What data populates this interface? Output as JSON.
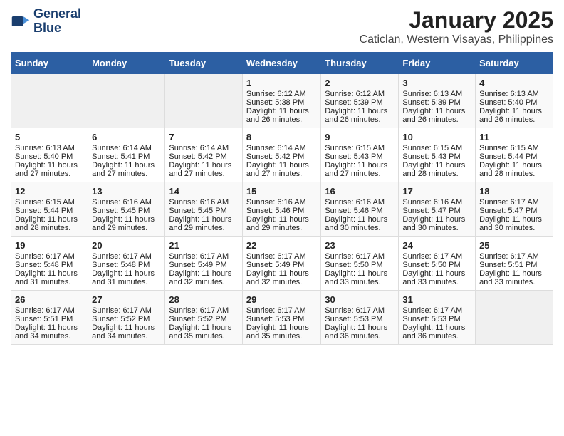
{
  "header": {
    "logo_line1": "General",
    "logo_line2": "Blue",
    "title": "January 2025",
    "subtitle": "Caticlan, Western Visayas, Philippines"
  },
  "weekdays": [
    "Sunday",
    "Monday",
    "Tuesday",
    "Wednesday",
    "Thursday",
    "Friday",
    "Saturday"
  ],
  "weeks": [
    [
      {
        "day": "",
        "sunrise": "",
        "sunset": "",
        "daylight": ""
      },
      {
        "day": "",
        "sunrise": "",
        "sunset": "",
        "daylight": ""
      },
      {
        "day": "",
        "sunrise": "",
        "sunset": "",
        "daylight": ""
      },
      {
        "day": "1",
        "sunrise": "Sunrise: 6:12 AM",
        "sunset": "Sunset: 5:38 PM",
        "daylight": "Daylight: 11 hours and 26 minutes."
      },
      {
        "day": "2",
        "sunrise": "Sunrise: 6:12 AM",
        "sunset": "Sunset: 5:39 PM",
        "daylight": "Daylight: 11 hours and 26 minutes."
      },
      {
        "day": "3",
        "sunrise": "Sunrise: 6:13 AM",
        "sunset": "Sunset: 5:39 PM",
        "daylight": "Daylight: 11 hours and 26 minutes."
      },
      {
        "day": "4",
        "sunrise": "Sunrise: 6:13 AM",
        "sunset": "Sunset: 5:40 PM",
        "daylight": "Daylight: 11 hours and 26 minutes."
      }
    ],
    [
      {
        "day": "5",
        "sunrise": "Sunrise: 6:13 AM",
        "sunset": "Sunset: 5:40 PM",
        "daylight": "Daylight: 11 hours and 27 minutes."
      },
      {
        "day": "6",
        "sunrise": "Sunrise: 6:14 AM",
        "sunset": "Sunset: 5:41 PM",
        "daylight": "Daylight: 11 hours and 27 minutes."
      },
      {
        "day": "7",
        "sunrise": "Sunrise: 6:14 AM",
        "sunset": "Sunset: 5:42 PM",
        "daylight": "Daylight: 11 hours and 27 minutes."
      },
      {
        "day": "8",
        "sunrise": "Sunrise: 6:14 AM",
        "sunset": "Sunset: 5:42 PM",
        "daylight": "Daylight: 11 hours and 27 minutes."
      },
      {
        "day": "9",
        "sunrise": "Sunrise: 6:15 AM",
        "sunset": "Sunset: 5:43 PM",
        "daylight": "Daylight: 11 hours and 27 minutes."
      },
      {
        "day": "10",
        "sunrise": "Sunrise: 6:15 AM",
        "sunset": "Sunset: 5:43 PM",
        "daylight": "Daylight: 11 hours and 28 minutes."
      },
      {
        "day": "11",
        "sunrise": "Sunrise: 6:15 AM",
        "sunset": "Sunset: 5:44 PM",
        "daylight": "Daylight: 11 hours and 28 minutes."
      }
    ],
    [
      {
        "day": "12",
        "sunrise": "Sunrise: 6:15 AM",
        "sunset": "Sunset: 5:44 PM",
        "daylight": "Daylight: 11 hours and 28 minutes."
      },
      {
        "day": "13",
        "sunrise": "Sunrise: 6:16 AM",
        "sunset": "Sunset: 5:45 PM",
        "daylight": "Daylight: 11 hours and 29 minutes."
      },
      {
        "day": "14",
        "sunrise": "Sunrise: 6:16 AM",
        "sunset": "Sunset: 5:45 PM",
        "daylight": "Daylight: 11 hours and 29 minutes."
      },
      {
        "day": "15",
        "sunrise": "Sunrise: 6:16 AM",
        "sunset": "Sunset: 5:46 PM",
        "daylight": "Daylight: 11 hours and 29 minutes."
      },
      {
        "day": "16",
        "sunrise": "Sunrise: 6:16 AM",
        "sunset": "Sunset: 5:46 PM",
        "daylight": "Daylight: 11 hours and 30 minutes."
      },
      {
        "day": "17",
        "sunrise": "Sunrise: 6:16 AM",
        "sunset": "Sunset: 5:47 PM",
        "daylight": "Daylight: 11 hours and 30 minutes."
      },
      {
        "day": "18",
        "sunrise": "Sunrise: 6:17 AM",
        "sunset": "Sunset: 5:47 PM",
        "daylight": "Daylight: 11 hours and 30 minutes."
      }
    ],
    [
      {
        "day": "19",
        "sunrise": "Sunrise: 6:17 AM",
        "sunset": "Sunset: 5:48 PM",
        "daylight": "Daylight: 11 hours and 31 minutes."
      },
      {
        "day": "20",
        "sunrise": "Sunrise: 6:17 AM",
        "sunset": "Sunset: 5:48 PM",
        "daylight": "Daylight: 11 hours and 31 minutes."
      },
      {
        "day": "21",
        "sunrise": "Sunrise: 6:17 AM",
        "sunset": "Sunset: 5:49 PM",
        "daylight": "Daylight: 11 hours and 32 minutes."
      },
      {
        "day": "22",
        "sunrise": "Sunrise: 6:17 AM",
        "sunset": "Sunset: 5:49 PM",
        "daylight": "Daylight: 11 hours and 32 minutes."
      },
      {
        "day": "23",
        "sunrise": "Sunrise: 6:17 AM",
        "sunset": "Sunset: 5:50 PM",
        "daylight": "Daylight: 11 hours and 33 minutes."
      },
      {
        "day": "24",
        "sunrise": "Sunrise: 6:17 AM",
        "sunset": "Sunset: 5:50 PM",
        "daylight": "Daylight: 11 hours and 33 minutes."
      },
      {
        "day": "25",
        "sunrise": "Sunrise: 6:17 AM",
        "sunset": "Sunset: 5:51 PM",
        "daylight": "Daylight: 11 hours and 33 minutes."
      }
    ],
    [
      {
        "day": "26",
        "sunrise": "Sunrise: 6:17 AM",
        "sunset": "Sunset: 5:51 PM",
        "daylight": "Daylight: 11 hours and 34 minutes."
      },
      {
        "day": "27",
        "sunrise": "Sunrise: 6:17 AM",
        "sunset": "Sunset: 5:52 PM",
        "daylight": "Daylight: 11 hours and 34 minutes."
      },
      {
        "day": "28",
        "sunrise": "Sunrise: 6:17 AM",
        "sunset": "Sunset: 5:52 PM",
        "daylight": "Daylight: 11 hours and 35 minutes."
      },
      {
        "day": "29",
        "sunrise": "Sunrise: 6:17 AM",
        "sunset": "Sunset: 5:53 PM",
        "daylight": "Daylight: 11 hours and 35 minutes."
      },
      {
        "day": "30",
        "sunrise": "Sunrise: 6:17 AM",
        "sunset": "Sunset: 5:53 PM",
        "daylight": "Daylight: 11 hours and 36 minutes."
      },
      {
        "day": "31",
        "sunrise": "Sunrise: 6:17 AM",
        "sunset": "Sunset: 5:53 PM",
        "daylight": "Daylight: 11 hours and 36 minutes."
      },
      {
        "day": "",
        "sunrise": "",
        "sunset": "",
        "daylight": ""
      }
    ]
  ]
}
